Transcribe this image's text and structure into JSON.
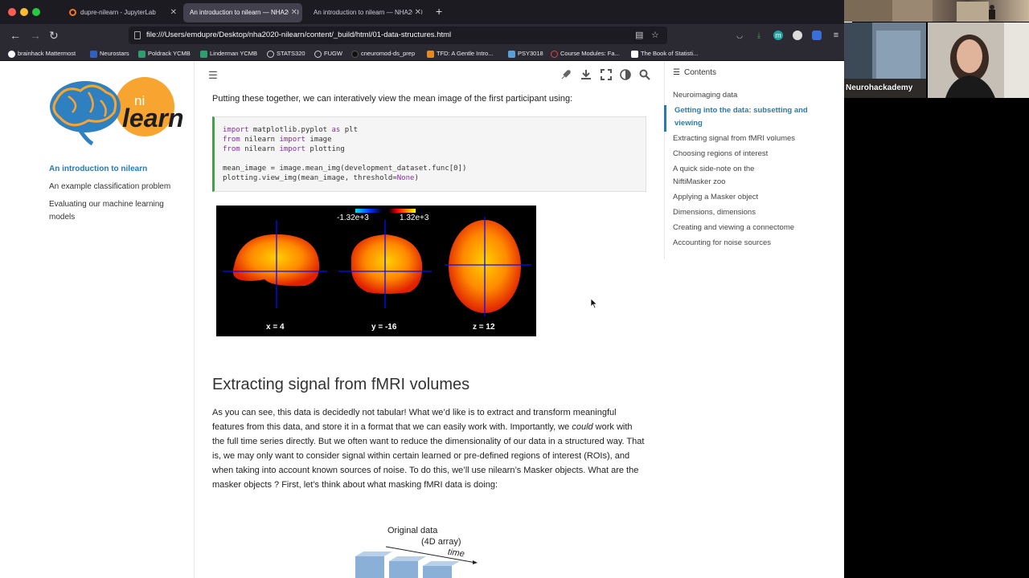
{
  "browser": {
    "tabs": [
      {
        "label": "dupre-nilearn - JupyterLab",
        "active": false
      },
      {
        "label": "An introduction to nilearn — NHA2020",
        "active": true
      },
      {
        "label": "An introduction to nilearn — NHA2020",
        "active": false
      }
    ],
    "url": "file:///Users/emdupre/Desktop/nha2020-nilearn/content/_build/html/01-data-structures.html",
    "bookmarks": [
      "brainhack Mattermost",
      "Neurostars",
      "Poldrack YCMB",
      "Linderman YCMB",
      "STATS320",
      "FUGW",
      "cneuromod-ds_prep",
      "TFD: A Gentle Intro...",
      "PSY3018",
      "Course Modules: Fa...",
      "The Book of Statisti..."
    ]
  },
  "sidebar": {
    "logo_text": {
      "ni": "ni",
      "learn": "learn"
    },
    "items": [
      {
        "label": "An introduction to nilearn",
        "active": true
      },
      {
        "label": "An example classification problem",
        "active": false
      },
      {
        "label": "Evaluating our machine learning models",
        "active": false
      }
    ]
  },
  "content": {
    "intro": "Putting these together, we can interatively view the mean image of the first participant using:",
    "code": {
      "l1": [
        "import",
        " matplotlib.pyplot ",
        "as",
        " plt"
      ],
      "l2": [
        "from",
        " nilearn ",
        "import",
        " image"
      ],
      "l3": [
        "from",
        " nilearn ",
        "import",
        " plotting"
      ],
      "l4": "mean_image = image.mean_img(development_dataset.func[0])",
      "l5a": "plotting.view_img(mean_image, threshold=",
      "l5b": "None",
      "l5c": ")"
    },
    "figure": {
      "colorbar_min": "-1.32e+3",
      "colorbar_max": "1.32e+3",
      "coords": [
        "x = 4",
        "y = -16",
        "z = 12"
      ]
    },
    "heading": "Extracting signal from fMRI volumes",
    "body_part1": "As you can see, this data is decidedly not tabular! What we’d like is to extract and transform meaningful features from this data, and store it in a format that we can easily work with. Importantly, we ",
    "body_em": "could",
    "body_part2": " work with the full time series directly. But we often want to reduce the dimensionality of our data in a structured way. That is, we may only want to consider signal within certain learned or pre-defined regions of interest (ROIs), and when taking into account known sources of noise. To do this, we’ll use nilearn’s Masker objects. What are the masker objects ? First, let’s think about what masking fMRI data is doing:",
    "diagram": {
      "title": "Original data",
      "subtitle": "(4D array)",
      "axis": "time"
    }
  },
  "toc": {
    "title": "Contents",
    "items": [
      {
        "label": "Neuroimaging data",
        "active": false
      },
      {
        "label": "Getting into the data: subsetting and viewing",
        "active": true
      },
      {
        "label": "Extracting signal from fMRI volumes",
        "active": false
      },
      {
        "label": "Choosing regions of interest",
        "active": false
      },
      {
        "label": "A quick side-note on the NiftiMasker zoo",
        "active": false
      },
      {
        "label": "Applying a Masker object",
        "active": false
      },
      {
        "label": "Dimensions, dimensions",
        "active": false
      },
      {
        "label": "Creating and viewing a connectome",
        "active": false
      },
      {
        "label": "Accounting for noise sources",
        "active": false
      }
    ]
  },
  "video": {
    "participant_name": "Neurohackademy"
  },
  "colors": {
    "accent": "#2a7ab0",
    "code_border": "#43a047",
    "tab_bar": "#1c1b22",
    "nav_bar": "#2b2a33"
  }
}
